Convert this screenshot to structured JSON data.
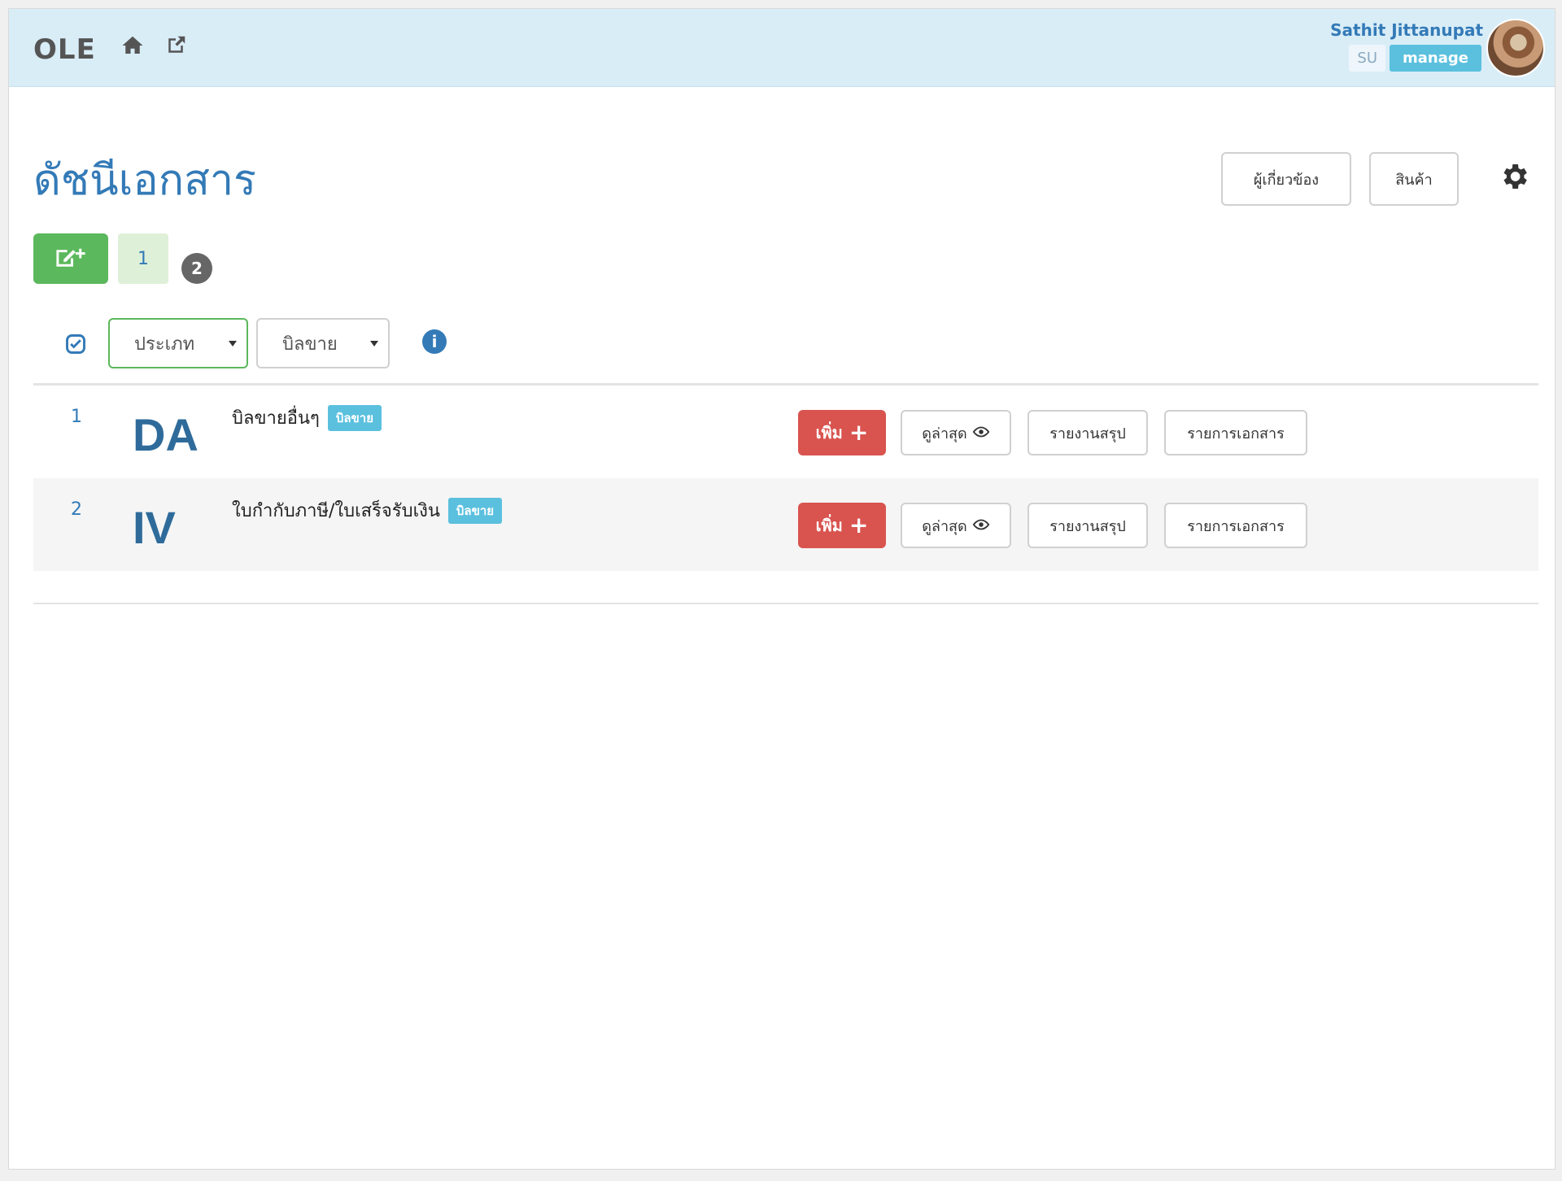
{
  "header": {
    "brand": "OLE",
    "user_name": "Sathit Jittanupat",
    "role_badge": "SU",
    "manage_badge": "manage",
    "icons": [
      "home-icon",
      "external-link-icon"
    ]
  },
  "page": {
    "title": "ดัชนีเอกสาร",
    "related_button": "ผู้เกี่ยวข้อง",
    "products_button": "สินค้า"
  },
  "toolbar": {
    "page_number": "1",
    "count_badge": "2"
  },
  "filters": {
    "type_select": "ประเภท",
    "category_select": "บิลขาย"
  },
  "rows": [
    {
      "num": "1",
      "code": "DA",
      "name": "บิลขายอื่นๆ",
      "tag": "บิลขาย",
      "add_label": "เพิ่ม",
      "latest_label": "ดูล่าสุด",
      "summary_label": "รายงานสรุป",
      "list_label": "รายการเอกสาร"
    },
    {
      "num": "2",
      "code": "IV",
      "name": "ใบกำกับภาษี/ใบเสร็จรับเงิน",
      "tag": "บิลขาย",
      "add_label": "เพิ่ม",
      "latest_label": "ดูล่าสุด",
      "summary_label": "รายงานสรุป",
      "list_label": "รายการเอกสาร"
    }
  ],
  "colors": {
    "header_bg": "#d9edf7",
    "primary": "#337ab7",
    "success": "#5cb85c",
    "danger": "#d9534f",
    "info": "#5bc0de"
  }
}
